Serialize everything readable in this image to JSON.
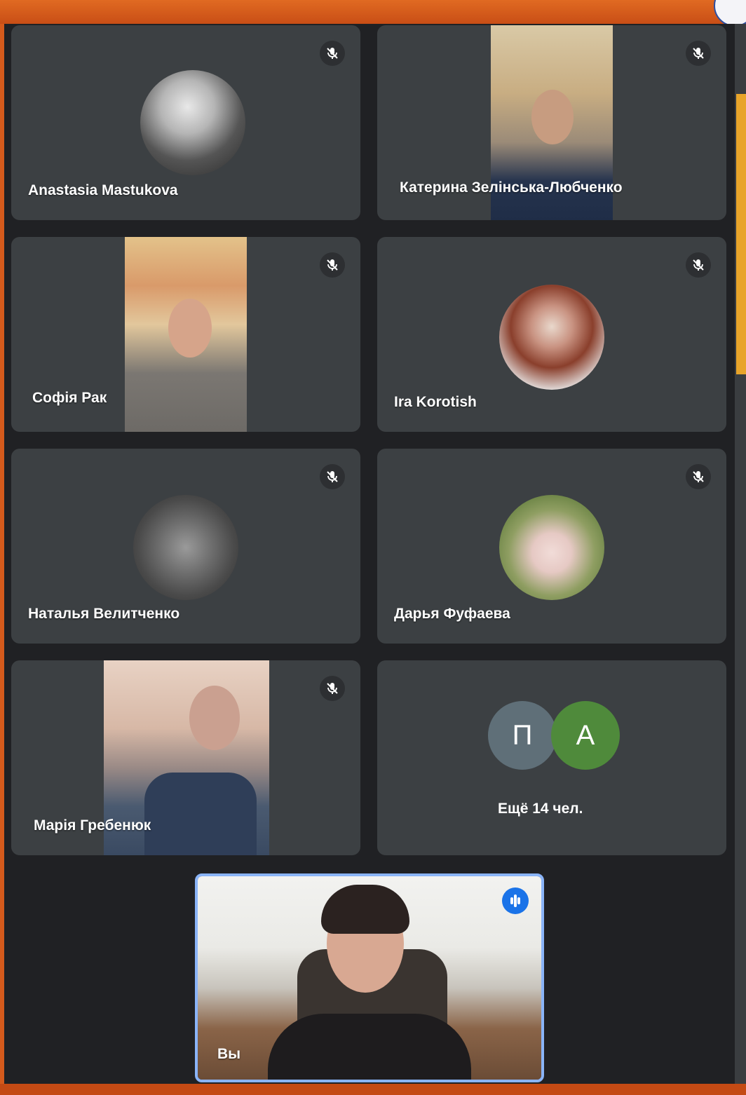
{
  "participants": [
    {
      "name": "Anastasia Mastukova",
      "display": "avatar",
      "muted": true
    },
    {
      "name": "Катерина Зелінська-Любченко",
      "display": "video",
      "muted": true
    },
    {
      "name": "Софія Рак",
      "display": "video",
      "muted": true
    },
    {
      "name": "Ira Korotish",
      "display": "avatar",
      "muted": true
    },
    {
      "name": "Наталья Велитченко",
      "display": "avatar",
      "muted": true
    },
    {
      "name": "Дарья Фуфаева",
      "display": "avatar",
      "muted": true
    },
    {
      "name": "Марія Гребенюк",
      "display": "video",
      "muted": true
    }
  ],
  "more_tile": {
    "initials": [
      "П",
      "А"
    ],
    "initial_colors": [
      "#5f6f78",
      "#4f8a3b"
    ],
    "label": "Ещё 14 чел."
  },
  "self_tile": {
    "label": "Вы",
    "speaking": true
  },
  "icons": {
    "mute": "mic-off-icon",
    "speaking": "speaking-indicator-icon"
  },
  "colors": {
    "background": "#202124",
    "tile": "#3c4043",
    "self_border": "#8ab4f8",
    "speaking_badge": "#1a73e8",
    "frame": "#d45a1c"
  }
}
